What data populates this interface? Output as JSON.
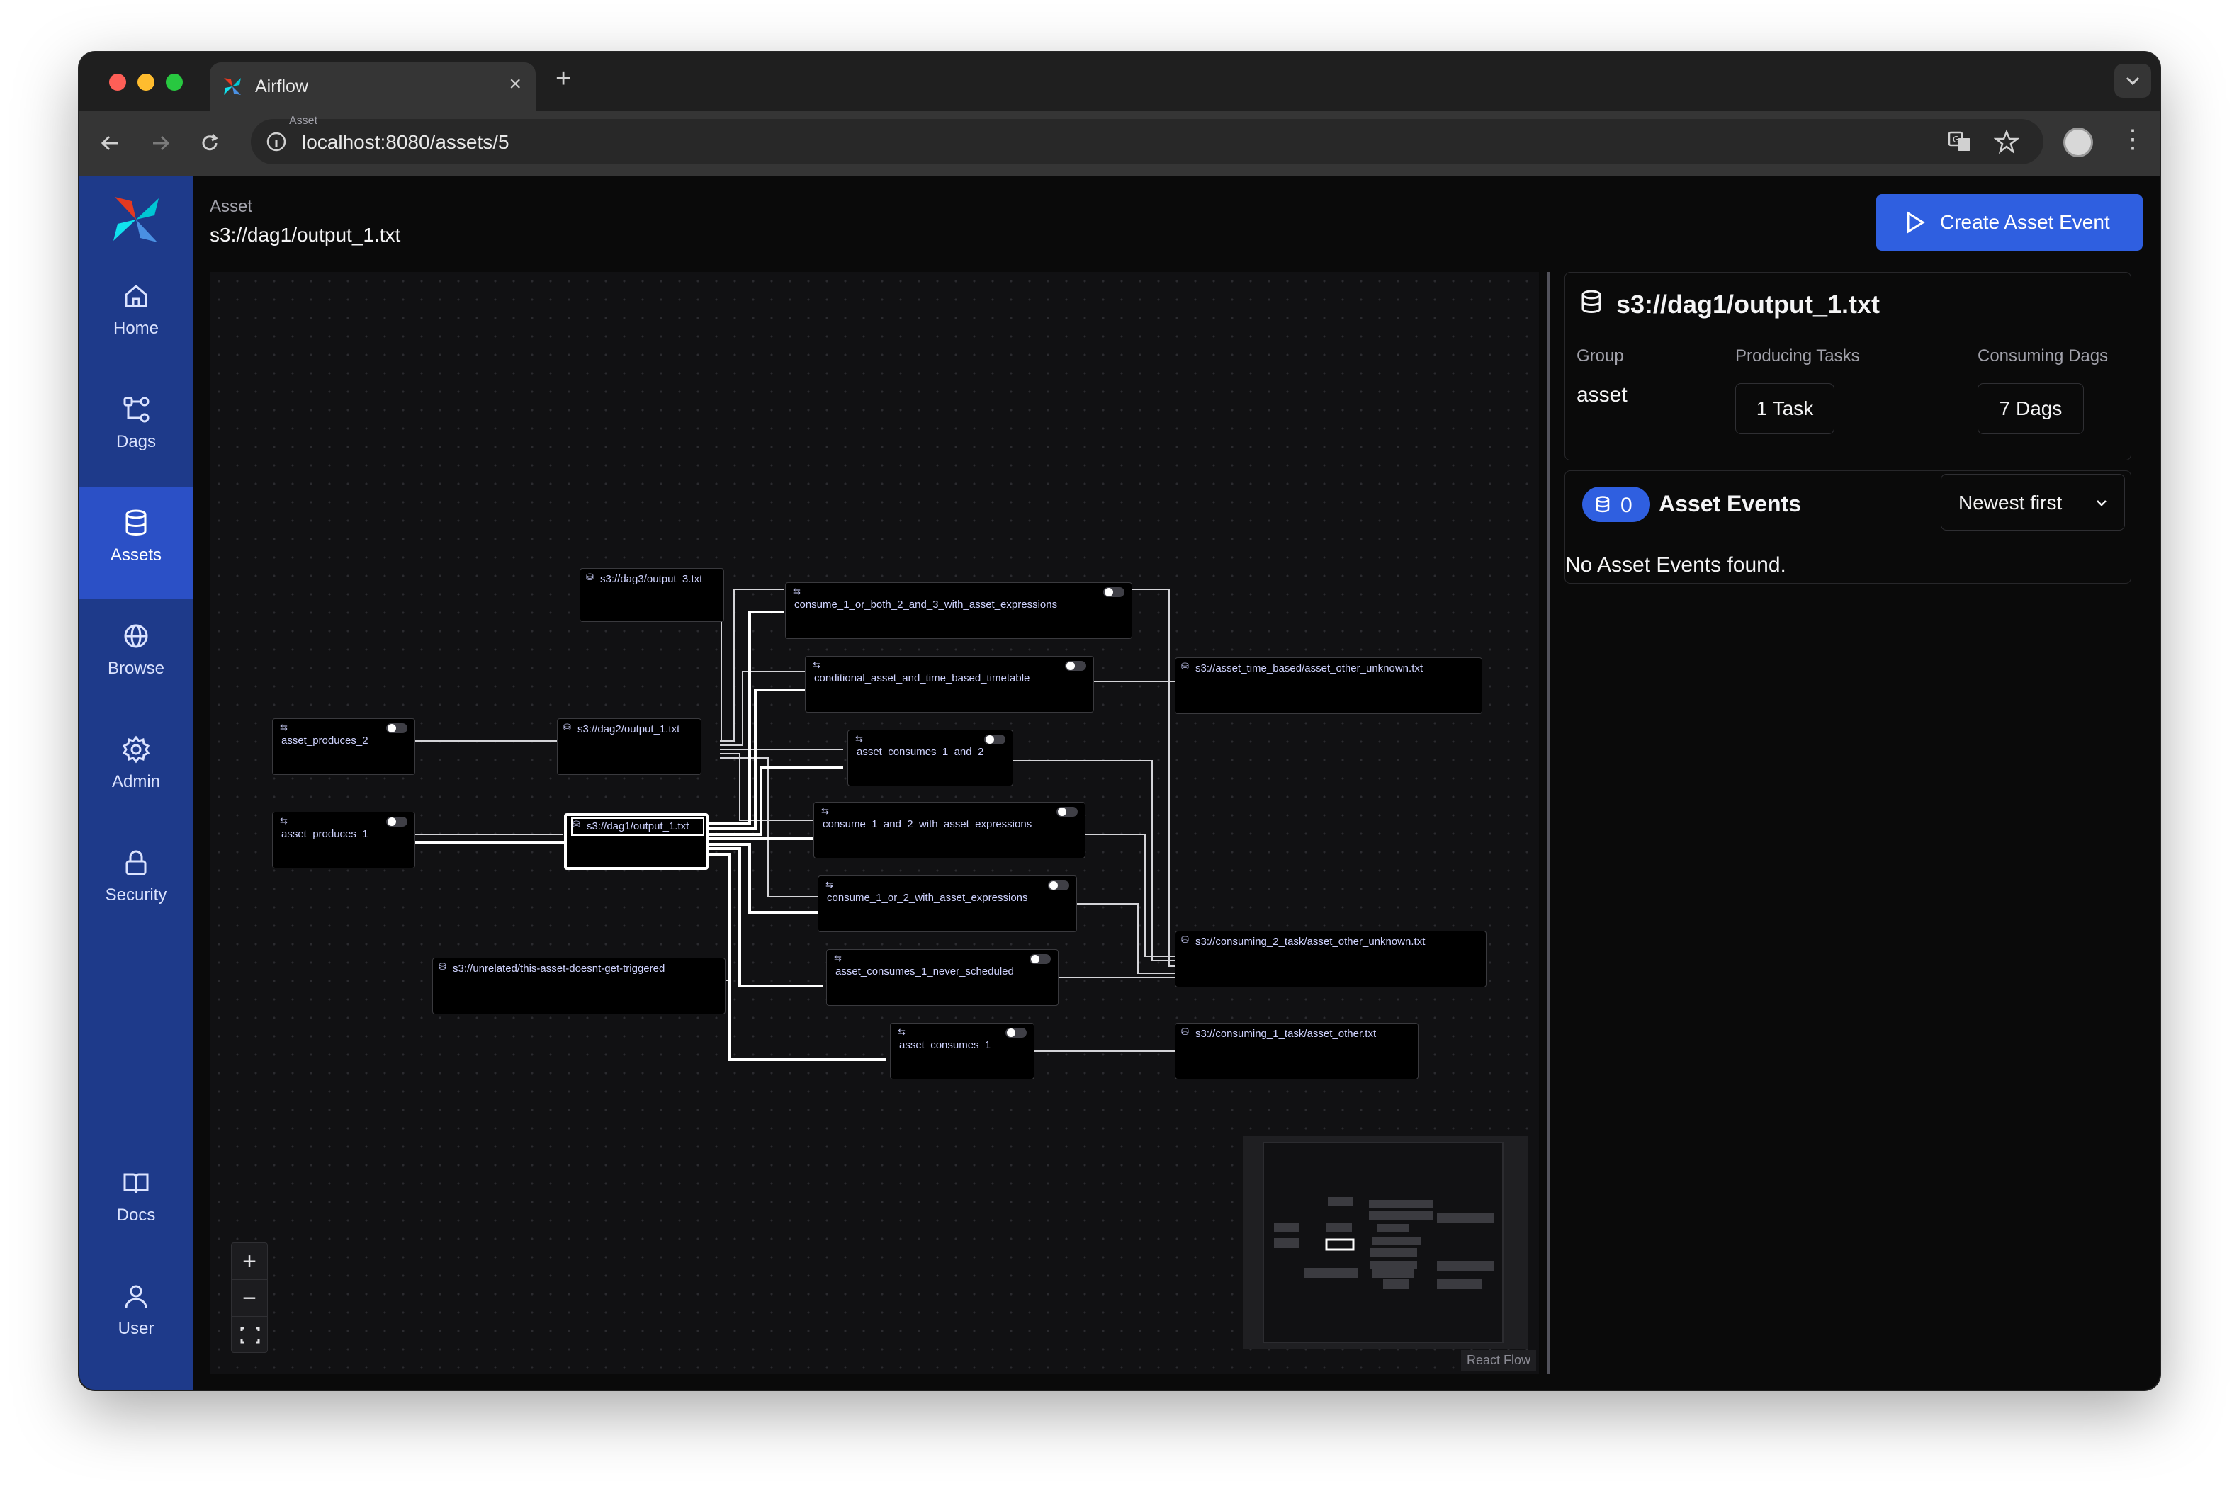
{
  "browser": {
    "tab_title": "Airflow",
    "url": "localhost:8080/assets/5",
    "icons": [
      "pinwheel-favicon",
      "close-icon",
      "new-tab-icon",
      "back-icon",
      "forward-icon",
      "reload-icon",
      "site-info-icon",
      "translate-icon",
      "bookmark-star-icon",
      "profile-avatar",
      "more-menu-icon",
      "tab-list-chevron-icon"
    ]
  },
  "sidebar": {
    "items": [
      {
        "label": "Home",
        "icon": "home-icon"
      },
      {
        "label": "Dags",
        "icon": "dags-icon"
      },
      {
        "label": "Assets",
        "icon": "database-icon",
        "active": true
      },
      {
        "label": "Browse",
        "icon": "globe-icon"
      },
      {
        "label": "Admin",
        "icon": "gear-icon"
      },
      {
        "label": "Security",
        "icon": "lock-icon"
      },
      {
        "label": "Docs",
        "icon": "book-icon"
      },
      {
        "label": "User",
        "icon": "user-icon"
      }
    ]
  },
  "header": {
    "label": "Asset",
    "name": "s3://dag1/output_1.txt",
    "create_button": "Create Asset Event"
  },
  "graph": {
    "nodes": [
      {
        "label": "s3://dag3/output_3.txt",
        "kind": "asset"
      },
      {
        "label": "consume_1_or_both_2_and_3_with_asset_expressions",
        "kind": "dag"
      },
      {
        "label": "conditional_asset_and_time_based_timetable",
        "kind": "dag"
      },
      {
        "label": "s3://asset_time_based/asset_other_unknown.txt",
        "kind": "asset"
      },
      {
        "label": "asset_produces_2",
        "kind": "dag"
      },
      {
        "label": "s3://dag2/output_1.txt",
        "kind": "asset"
      },
      {
        "label": "asset_consumes_1_and_2",
        "kind": "dag"
      },
      {
        "label": "asset_produces_1",
        "kind": "dag"
      },
      {
        "label": "s3://dag1/output_1.txt",
        "kind": "asset",
        "selected": true
      },
      {
        "label": "consume_1_and_2_with_asset_expressions",
        "kind": "dag"
      },
      {
        "label": "consume_1_or_2_with_asset_expressions",
        "kind": "dag"
      },
      {
        "label": "s3://consuming_2_task/asset_other_unknown.txt",
        "kind": "asset"
      },
      {
        "label": "s3://unrelated/this-asset-doesnt-get-triggered",
        "kind": "asset"
      },
      {
        "label": "asset_consumes_1_never_scheduled",
        "kind": "dag"
      },
      {
        "label": "asset_consumes_1",
        "kind": "dag"
      },
      {
        "label": "s3://consuming_1_task/asset_other.txt",
        "kind": "asset"
      }
    ],
    "controls": {
      "zoom_in": "+",
      "zoom_out": "−",
      "fit": "fit-view-icon"
    },
    "attribution": "React Flow"
  },
  "details": {
    "title": "s3://dag1/output_1.txt",
    "group_label": "Group",
    "group_value": "asset",
    "producing_label": "Producing Tasks",
    "producing_value": "1 Task",
    "consuming_label": "Consuming Dags",
    "consuming_value": "7 Dags"
  },
  "events": {
    "count": "0",
    "title": "Asset Events",
    "sort": "Newest first",
    "empty": "No Asset Events found."
  },
  "colors": {
    "sidebar": "#1e3a8a",
    "sidebar_active": "#2b50c6",
    "primary_button": "#2f5fe0",
    "badge": "#2f5fe0"
  }
}
